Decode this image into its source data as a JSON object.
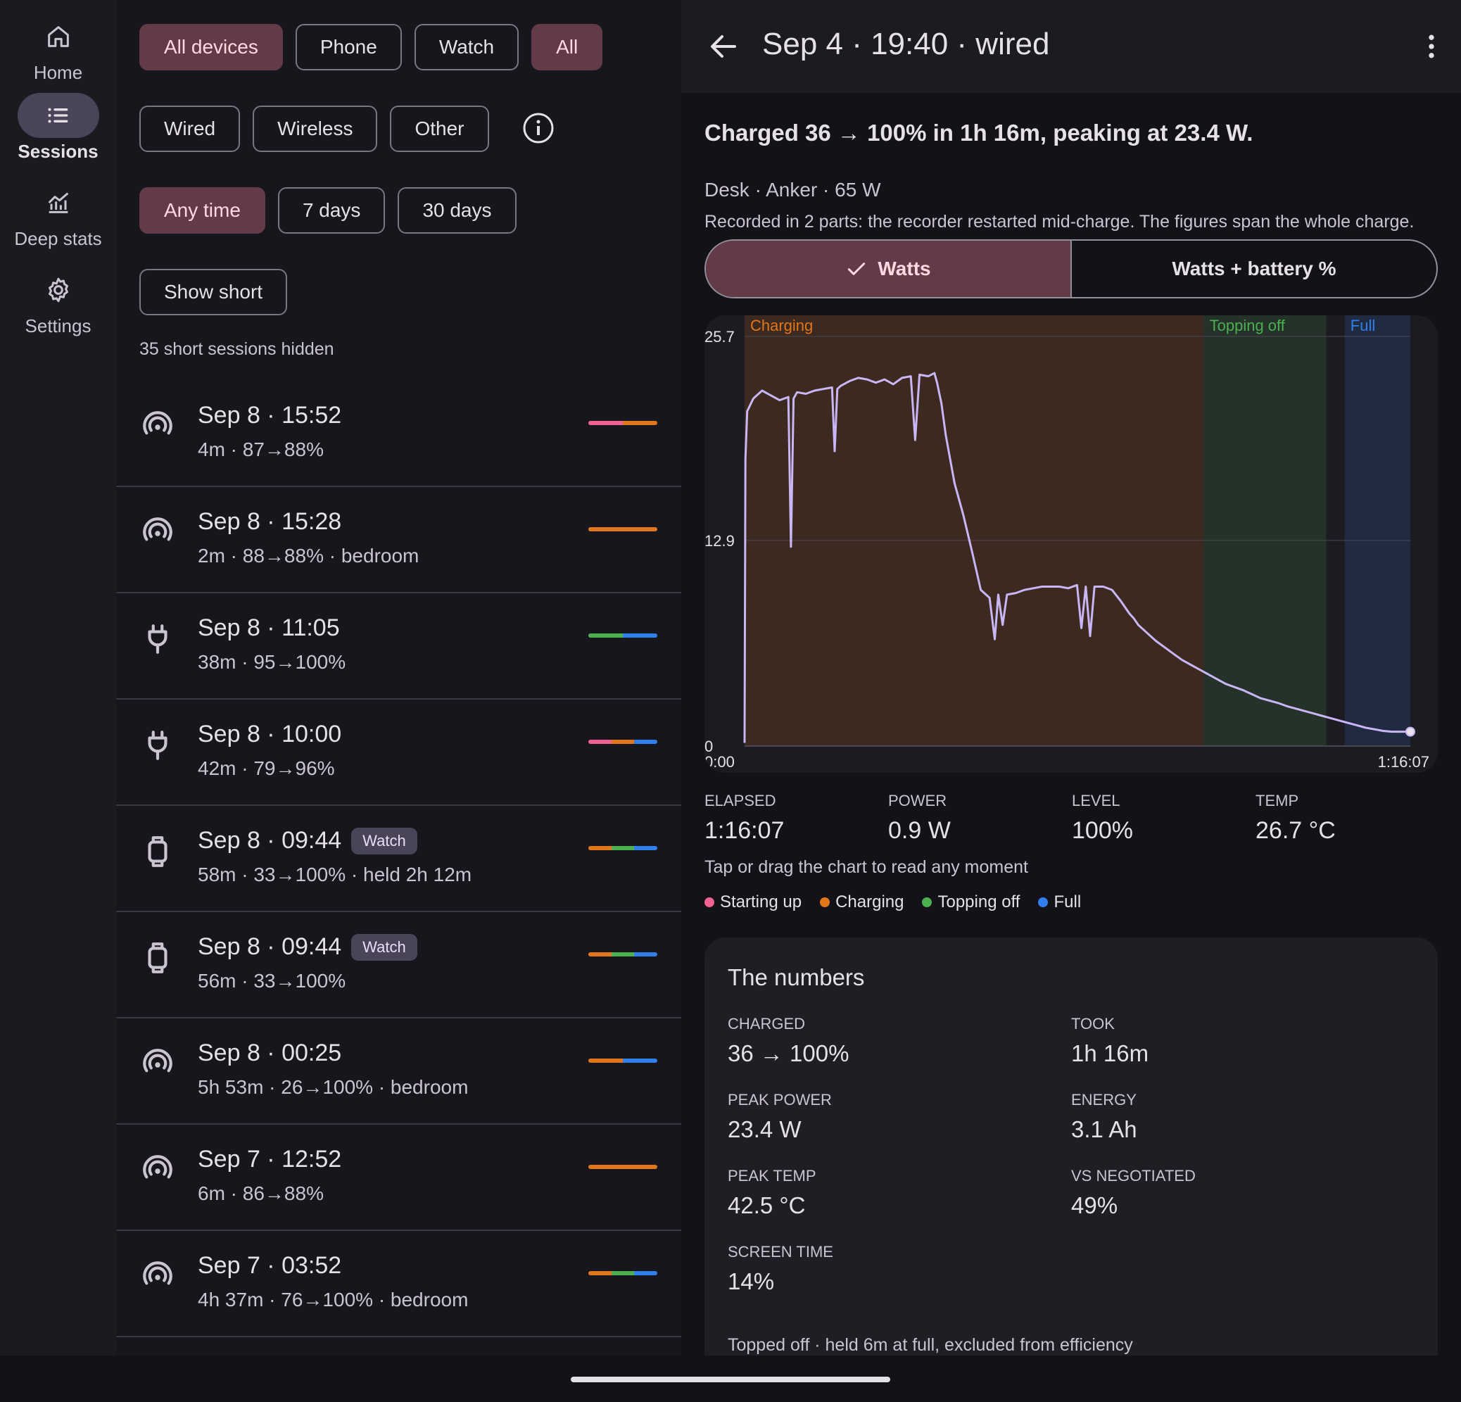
{
  "rail": {
    "items": [
      {
        "label": "Home",
        "icon": "home-icon"
      },
      {
        "label": "Sessions",
        "icon": "list-icon",
        "active": true
      },
      {
        "label": "Deep stats",
        "icon": "chart-icon"
      },
      {
        "label": "Settings",
        "icon": "gear-icon"
      }
    ]
  },
  "filters": {
    "device_chips": [
      "All devices",
      "Phone",
      "Watch",
      "All"
    ],
    "type_chips": [
      "Wired",
      "Wireless",
      "Other"
    ],
    "time_chips": [
      "Any time",
      "7 days",
      "30 days"
    ],
    "show_short": "Show short",
    "hidden_note": "35 short sessions hidden"
  },
  "sessions": [
    {
      "title": "Sep 8 · 15:52",
      "sub": "4m · 87→88%",
      "icon": "wireless-icon",
      "badge": "",
      "phases": [
        "#f06292",
        "#e2761a"
      ]
    },
    {
      "title": "Sep 8 · 15:28",
      "sub": "2m · 88→88% · bedroom",
      "icon": "wireless-icon",
      "badge": "",
      "phases": [
        "#e2761a"
      ]
    },
    {
      "title": "Sep 8 · 11:05",
      "sub": "38m · 95→100%",
      "icon": "plug-icon",
      "badge": "",
      "phases": [
        "#4caf50",
        "#2f80ed"
      ]
    },
    {
      "title": "Sep 8 · 10:00",
      "sub": "42m · 79→96%",
      "icon": "plug-icon",
      "badge": "",
      "phases": [
        "#f06292",
        "#e2761a",
        "#2f80ed"
      ]
    },
    {
      "title": "Sep 8 · 09:44",
      "sub": "58m · 33→100% · held 2h 12m",
      "icon": "watch-icon",
      "badge": "Watch",
      "phases": [
        "#e2761a",
        "#4caf50",
        "#2f80ed"
      ]
    },
    {
      "title": "Sep 8 · 09:44",
      "sub": "56m · 33→100%",
      "icon": "watch-icon",
      "badge": "Watch",
      "phases": [
        "#e2761a",
        "#4caf50",
        "#2f80ed"
      ]
    },
    {
      "title": "Sep 8 · 00:25",
      "sub": "5h 53m · 26→100% · bedroom",
      "icon": "wireless-icon",
      "badge": "",
      "phases": [
        "#e2761a",
        "#2f80ed"
      ]
    },
    {
      "title": "Sep 7 · 12:52",
      "sub": "6m · 86→88%",
      "icon": "wireless-icon",
      "badge": "",
      "phases": [
        "#e2761a"
      ]
    },
    {
      "title": "Sep 7 · 03:52",
      "sub": "4h 37m · 76→100% · bedroom",
      "icon": "wireless-icon",
      "badge": "",
      "phases": [
        "#e2761a",
        "#4caf50",
        "#2f80ed"
      ]
    }
  ],
  "detail": {
    "title": "Sep 4 · 19:40 · wired",
    "summary": "Charged 36 → 100% in 1h 16m, peaking at 23.4 W.",
    "meta": "Desk · Anker · 65 W",
    "record_note": "Recorded in 2 parts: the recorder restarted mid-charge. The figures span the whole charge.",
    "seg_watts": "Watts",
    "seg_watts_battery": "Watts + battery %",
    "readouts": [
      {
        "label": "ELAPSED",
        "value": "1:16:07"
      },
      {
        "label": "POWER",
        "value": "0.9 W"
      },
      {
        "label": "LEVEL",
        "value": "100%"
      },
      {
        "label": "TEMP",
        "value": "26.7 °C"
      }
    ],
    "tap_hint": "Tap or drag the chart to read any moment",
    "legend": [
      {
        "label": "Starting up",
        "color": "#f06292"
      },
      {
        "label": "Charging",
        "color": "#e2761a"
      },
      {
        "label": "Topping off",
        "color": "#4caf50"
      },
      {
        "label": "Full",
        "color": "#2f80ed"
      }
    ],
    "numbers_title": "The numbers",
    "numbers": [
      {
        "label": "CHARGED",
        "value": "36 → 100%"
      },
      {
        "label": "TOOK",
        "value": "1h 16m"
      },
      {
        "label": "PEAK POWER",
        "value": "23.4 W"
      },
      {
        "label": "ENERGY",
        "value": "3.1 Ah"
      },
      {
        "label": "PEAK TEMP",
        "value": "42.5 °C"
      },
      {
        "label": "VS NEGOTIATED",
        "value": "49%"
      },
      {
        "label": "SCREEN TIME",
        "value": "14%"
      }
    ],
    "numbers_foot": "Topped off · held 6m at full, excluded from efficiency"
  },
  "chart_data": {
    "type": "line",
    "title": "",
    "xlabel": "",
    "ylabel": "",
    "ylim": [
      0,
      25.7
    ],
    "yticks": [
      "25.7",
      "12.9",
      "0"
    ],
    "xticks": [
      "0:00",
      "1:16:07"
    ],
    "x_minutes": [
      0,
      0.1,
      0.3,
      1,
      2,
      3,
      4,
      5,
      5.3,
      5.6,
      6,
      7,
      8,
      9,
      10,
      10.3,
      10.6,
      11,
      12,
      13,
      14,
      15,
      16,
      17,
      18,
      19,
      19.5,
      20,
      21,
      21.7,
      22,
      22.5,
      23,
      24,
      25,
      26,
      27,
      28,
      28.6,
      29,
      29.5,
      30,
      31,
      32,
      33,
      34,
      35,
      36,
      37,
      38,
      38.5,
      39,
      39.5,
      40,
      41,
      42,
      43,
      44,
      44.5,
      45,
      46,
      47,
      48,
      49,
      50,
      51,
      52,
      53,
      54,
      55,
      56,
      57,
      58,
      59,
      60,
      61,
      62,
      63,
      64,
      65,
      66,
      67,
      68,
      69,
      70,
      71,
      72,
      73,
      74,
      75,
      76.1
    ],
    "series": [
      {
        "values": [
          0.2,
          18,
          21,
          21.8,
          22.3,
          22,
          21.7,
          21.9,
          12.5,
          21.8,
          22.2,
          22.1,
          22.3,
          22.4,
          22.5,
          18.5,
          22.4,
          22.6,
          22.9,
          23.1,
          23,
          22.8,
          23,
          22.7,
          23.1,
          23.2,
          19.2,
          23.3,
          23.2,
          23.4,
          22.8,
          21.5,
          19.5,
          16.5,
          14.5,
          12.2,
          9.8,
          9.3,
          6.7,
          9.5,
          7.6,
          9.5,
          9.6,
          9.8,
          9.9,
          10,
          10,
          10,
          9.9,
          10.1,
          7.4,
          10,
          6.9,
          10,
          10,
          9.8,
          9.1,
          8.3,
          8,
          7.6,
          7.1,
          6.6,
          6.2,
          5.8,
          5.4,
          5.1,
          4.8,
          4.5,
          4.2,
          3.9,
          3.7,
          3.5,
          3.25,
          3,
          2.85,
          2.7,
          2.5,
          2.35,
          2.2,
          2.05,
          1.9,
          1.75,
          1.6,
          1.45,
          1.3,
          1.15,
          1.05,
          0.95,
          0.9,
          0.9,
          0.9
        ],
        "color": "#c9b6f4"
      }
    ],
    "phase_labels": [
      "Charging",
      "Topping off",
      "Full"
    ],
    "phases_minutes": [
      {
        "name": "Charging",
        "start": 0,
        "end": 52.5,
        "color": "#e2761a"
      },
      {
        "name": "Topping off",
        "start": 52.5,
        "end": 66.5,
        "color": "#4caf50"
      },
      {
        "name": "Full",
        "start": 68.6,
        "end": 76.1,
        "color": "#2f80ed"
      }
    ],
    "grid": true
  }
}
